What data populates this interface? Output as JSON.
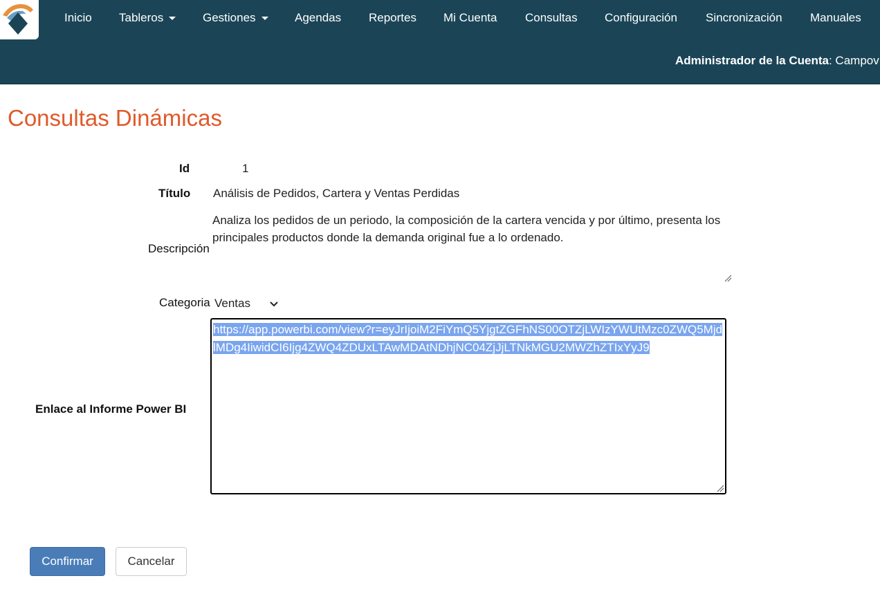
{
  "nav": {
    "items": [
      "Inicio",
      "Tableros",
      "Gestiones",
      "Agendas",
      "Reportes",
      "Mi Cuenta",
      "Consultas",
      "Configuración",
      "Sincronización",
      "Manuales"
    ],
    "admin_label": "Administrador de la Cuenta",
    "admin_value": ": Campov",
    "color": "#1b4556"
  },
  "page": {
    "title": "Consultas Dinámicas",
    "title_color": "#e0592a"
  },
  "form": {
    "id_label": "Id",
    "id_value": "1",
    "title_label": "Título",
    "title_value": "Análisis de Pedidos, Cartera y Ventas Perdidas",
    "description_label": "Descripción",
    "description_value": "Analiza los pedidos de un periodo, la composición de la cartera vencida y por último, presenta los principales productos donde la demanda original fue a lo ordenado.",
    "category_label": "Categoria",
    "category_value": "Ventas",
    "link_label": "Enlace al Informe Power BI",
    "link_value": "https://app.powerbi.com/view?r=eyJrIjoiM2FiYmQ5YjgtZGFhNS00OTZjLWIzYWUtMzc0ZWQ5MjdlMDg4IiwidCI6Ijg4ZWQ4ZDUxLTAwMDAtNDhjNC04ZjJjLTNkMGU2MWZhZTIxYyJ9"
  },
  "buttons": {
    "confirm": "Confirmar",
    "cancel": "Cancelar",
    "primary_color": "#4a7db8"
  },
  "icons": [
    "logo-icon",
    "caret-down-icon",
    "chevron-down-icon",
    "resize-grip-icon"
  ]
}
